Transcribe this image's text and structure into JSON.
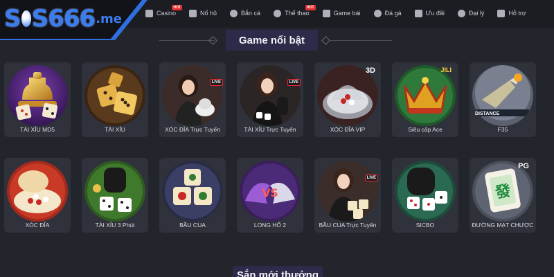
{
  "header": {
    "logo": {
      "prefix": "S",
      "middle": "S666",
      "tld": ".me"
    },
    "nav": [
      {
        "label": "Casino",
        "icon": "play-icon",
        "hot": "HOT"
      },
      {
        "label": "Nổ hũ",
        "icon": "slot-icon",
        "hot": ""
      },
      {
        "label": "Bắn cá",
        "icon": "fish-icon",
        "hot": ""
      },
      {
        "label": "Thể thao",
        "icon": "sports-icon",
        "hot": "HOT"
      },
      {
        "label": "Game bài",
        "icon": "cards-icon",
        "hot": ""
      },
      {
        "label": "Đá gà",
        "icon": "rooster-icon",
        "hot": ""
      },
      {
        "label": "Ưu đãi",
        "icon": "gift-icon",
        "hot": ""
      },
      {
        "label": "Đại lý",
        "icon": "agent-icon",
        "hot": ""
      },
      {
        "label": "Hỗ trợ",
        "icon": "support-icon",
        "hot": ""
      }
    ]
  },
  "section": {
    "title": "Game nổi bật"
  },
  "next_section": {
    "title": "Sắn mới thưởng"
  },
  "games": [
    {
      "label": "TÀI XỈU MD5",
      "icon": "golden-dice-cup-icon",
      "badge": ""
    },
    {
      "label": "TÀI XỈU",
      "icon": "gold-dice-icon",
      "badge": ""
    },
    {
      "label": "XÓC ĐĨA Trực Tuyến",
      "icon": "live-dealer-icon",
      "badge": "LIVE"
    },
    {
      "label": "TÀI XỈU Trực Tuyến",
      "icon": "live-dealer-icon",
      "badge": "LIVE"
    },
    {
      "label": "XÓC ĐĨA VIP",
      "icon": "glass-bowl-icon",
      "badge": "3D"
    },
    {
      "label": "Siêu cấp Ace",
      "icon": "crown-icon",
      "badge": "JILI"
    },
    {
      "label": "F35",
      "icon": "jet-icon",
      "badge": "DISTANCE"
    },
    {
      "label": "XÓC ĐĨA",
      "icon": "plate-bowl-icon",
      "badge": ""
    },
    {
      "label": "TÀI XỈU 3 Phút",
      "icon": "dice-cup-icon",
      "badge": ""
    },
    {
      "label": "BẦU CUA",
      "icon": "bau-cua-dice-icon",
      "badge": ""
    },
    {
      "label": "LONG HỔ 2",
      "icon": "dragon-tiger-icon",
      "badge": ""
    },
    {
      "label": "BẦU CUA Trực Tuyến",
      "icon": "live-dealer-icon",
      "badge": "LIVE"
    },
    {
      "label": "SICBO",
      "icon": "sicbo-icon",
      "badge": ""
    },
    {
      "label": "ĐƯỜNG MẠT CHƯỢC",
      "icon": "mahjong-icon",
      "badge": "PG"
    }
  ],
  "colors": {
    "background": "#23252c",
    "card": "#30323b",
    "accent": "#2f6fe0",
    "title_bg": "#2e2a4a",
    "hot": "#e0302f"
  }
}
